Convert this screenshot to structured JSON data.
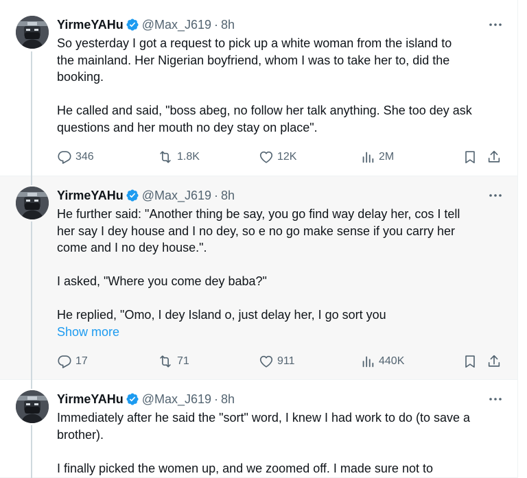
{
  "colors": {
    "accent": "#1d9bf0",
    "muted": "#536471",
    "text": "#0f1419",
    "thread_line": "#cfd9de"
  },
  "tweets": [
    {
      "name": "YirmeYAHu",
      "handle": "@Max_J619",
      "dot": "·",
      "time": "8h",
      "lines": [
        "So yesterday I got a request to pick up a white woman from the island to",
        "the mainland. Her Nigerian boyfriend, whom I was to take her to, did the",
        "booking.",
        "He called and said, \"boss abeg, no follow her talk anything. She too dey ask",
        "questions and her mouth no dey stay on place\"."
      ],
      "replies": "346",
      "retweets": "1.8K",
      "likes": "12K",
      "views": "2M"
    },
    {
      "name": "YirmeYAHu",
      "handle": "@Max_J619",
      "dot": "·",
      "time": "8h",
      "lines": [
        "He further said: \"Another thing be say, you go find way delay her, cos I tell",
        "her say I dey house and I no dey, so e no go make sense if you carry her",
        "come and I no dey house.\".",
        "I asked, \"Where you come dey baba?\"",
        "He replied, \"Omo, I dey Island o, just delay her, I go sort you"
      ],
      "show_more": "Show more",
      "replies": "17",
      "retweets": "71",
      "likes": "911",
      "views": "440K"
    },
    {
      "name": "YirmeYAHu",
      "handle": "@Max_J619",
      "dot": "·",
      "time": "8h",
      "lines": [
        "Immediately after he said the \"sort\" word, I knew I had work to do (to save a",
        "brother).",
        "I finally picked the women up, and we zoomed off. I made sure not to"
      ]
    }
  ]
}
